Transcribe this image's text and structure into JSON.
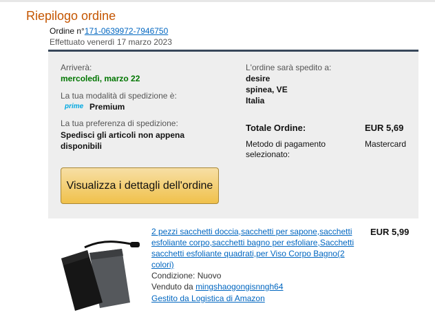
{
  "header": {
    "title": "Riepilogo ordine",
    "order_prefix": "Ordine n°",
    "order_number": "171-0639972-7946750",
    "placed_on": "Effettuato venerdì 17 marzo 2023"
  },
  "summary": {
    "arrival_label": "Arriverà:",
    "arrival_date": "mercoledì, marzo 22",
    "shipping_mode_label": "La tua modalità di spedizione è:",
    "prime_logo": "prime",
    "shipping_mode_value": "Premium",
    "shipping_pref_label": "La tua preferenza di spedizione:",
    "shipping_pref_value": "Spedisci gli articoli non appena disponibili",
    "view_details_button": "Visualizza i dettagli dell'ordine",
    "ship_to_label": "L'ordine sarà spedito a:",
    "ship_to_name": "desire",
    "ship_to_city": "spinea, VE",
    "ship_to_country": "Italia",
    "total_label": "Totale Ordine:",
    "total_value": "EUR 5,69",
    "payment_label": "Metodo di pagamento selezionato:",
    "payment_value": "Mastercard"
  },
  "item": {
    "title": "2 pezzi sacchetti doccia,sacchetti per sapone,sacchetti esfoliante corpo,sacchetti bagno per esfoliare,Sacchetti sacchetti esfoliante quadrati,per Viso Corpo Bagno(2 colori)",
    "price": "EUR 5,99",
    "condition": "Condizione: Nuovo",
    "sold_by_prefix": "Venduto da ",
    "seller": "mingshaogongisnngh64",
    "fulfilled_by": "Gestito da Logistica di Amazon"
  },
  "colors": {
    "title_orange": "#c45500",
    "link_blue": "#0066c0",
    "arrival_green": "#007600",
    "button_yellow": "#f0c14b"
  }
}
